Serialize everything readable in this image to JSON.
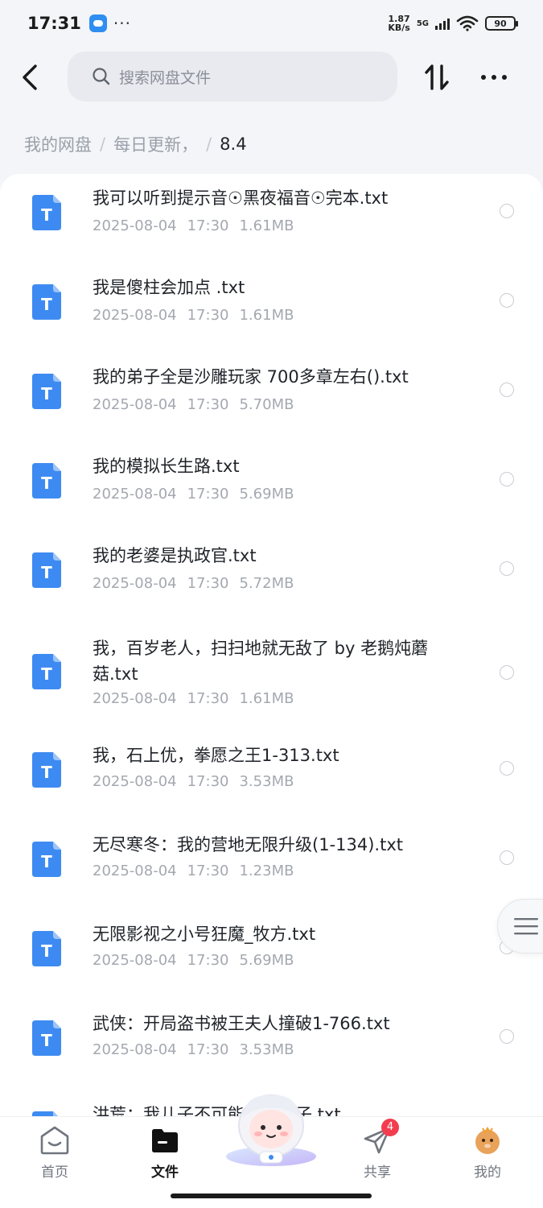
{
  "status_bar": {
    "time": "17:31",
    "dots": "···",
    "net_speed_value": "1.87",
    "net_speed_unit": "KB/s",
    "network": "5G",
    "battery": "90"
  },
  "top_bar": {
    "search_placeholder": "搜索网盘文件"
  },
  "breadcrumb": {
    "items": [
      "我的网盘",
      "每日更新，",
      "8.4"
    ],
    "separator": "/"
  },
  "files": [
    {
      "name": "我可以听到提示音☉黑夜福音☉完本.txt",
      "date": "2025-08-04",
      "time": "17:30",
      "size": "1.61MB"
    },
    {
      "name": "我是傻柱会加点 .txt",
      "date": "2025-08-04",
      "time": "17:30",
      "size": "1.61MB"
    },
    {
      "name": "我的弟子全是沙雕玩家 700多章左右().txt",
      "date": "2025-08-04",
      "time": "17:30",
      "size": "5.70MB"
    },
    {
      "name": "我的模拟长生路.txt",
      "date": "2025-08-04",
      "time": "17:30",
      "size": "5.69MB"
    },
    {
      "name": "我的老婆是执政官.txt",
      "date": "2025-08-04",
      "time": "17:30",
      "size": "5.72MB"
    },
    {
      "name": "我，百岁老人，扫扫地就无敌了 by 老鹅炖蘑菇.txt",
      "date": "2025-08-04",
      "time": "17:30",
      "size": "1.61MB"
    },
    {
      "name": "我，石上优，拳愿之王1-313.txt",
      "date": "2025-08-04",
      "time": "17:30",
      "size": "3.53MB"
    },
    {
      "name": "无尽寒冬：我的营地无限升级(1-134).txt",
      "date": "2025-08-04",
      "time": "17:30",
      "size": "1.23MB"
    },
    {
      "name": "无限影视之小号狂魔_牧方.txt",
      "date": "2025-08-04",
      "time": "17:30",
      "size": "5.69MB"
    },
    {
      "name": "武侠：开局盗书被王夫人撞破1-766.txt",
      "date": "2025-08-04",
      "time": "17:30",
      "size": "3.53MB"
    },
    {
      "name": "洪荒：我儿子不可能是……子.txt",
      "date": "",
      "time": "",
      "size": ""
    }
  ],
  "bottom_nav": {
    "items": [
      {
        "label": "首页",
        "icon": "home-icon"
      },
      {
        "label": "文件",
        "icon": "folder-icon"
      },
      {
        "label": "共享",
        "icon": "send-icon",
        "badge": "4"
      },
      {
        "label": "我的",
        "icon": "avatar-icon"
      }
    ]
  },
  "file_icon_letter": "T",
  "colors": {
    "accent": "#3d8bf2",
    "badge": "#f23d4f"
  }
}
